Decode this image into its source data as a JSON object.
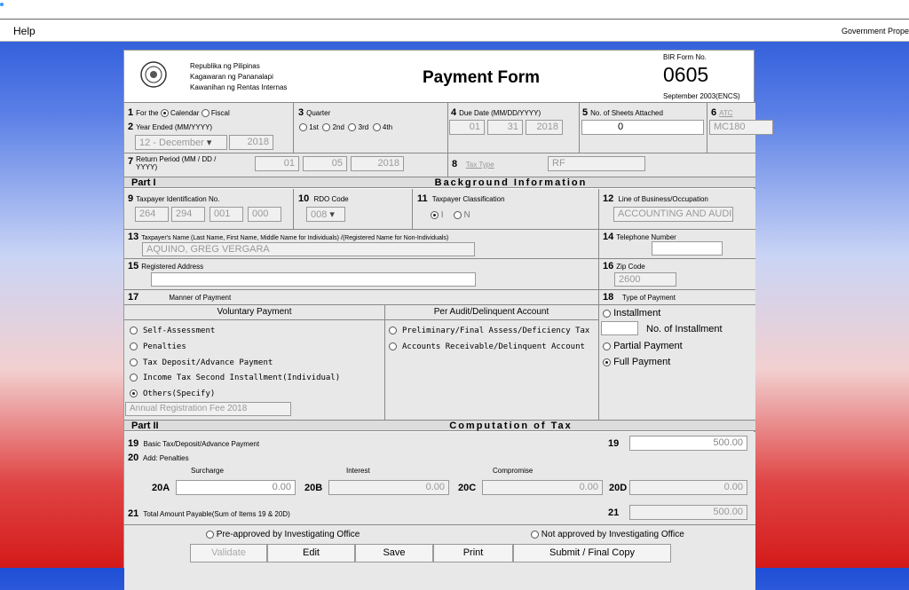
{
  "window": {
    "help": "Help",
    "gov": "Government Prope"
  },
  "header": {
    "line1": "Republika ng Pilipinas",
    "line2": "Kagawaran ng Pananalapi",
    "line3": "Kawanihan ng Rentas Internas",
    "title": "Payment Form",
    "bir_label": "BIR Form No.",
    "form_no": "0605",
    "edition": "September 2003(ENCS)"
  },
  "row1": {
    "f1_label": "For the",
    "calendar": "Calendar",
    "fiscal": "Fiscal",
    "f2_label": "Year Ended (MM/YYYY)",
    "month": "12 - December",
    "year": "2018",
    "f3_label": "Quarter",
    "q1": "1st",
    "q2": "2nd",
    "q3": "3rd",
    "q4": "4th",
    "f4_label": "Due Date (MM/DD/YYYY)",
    "due_mm": "01",
    "due_dd": "31",
    "due_yyyy": "2018",
    "f5_label": "No. of Sheets Attached",
    "sheets": "0",
    "f6_label": "ATC",
    "atc": "MC180"
  },
  "row2": {
    "f7_label": "Return Period (MM / DD / YYYY)",
    "rp_mm": "01",
    "rp_dd": "05",
    "rp_yyyy": "2018",
    "f8_label": "Tax Type",
    "tax_type": "RF"
  },
  "part1": {
    "p": "Part I",
    "t": "Background Information"
  },
  "bg": {
    "f9": "Taxpayer Identification No.",
    "tin1": "264",
    "tin2": "294",
    "tin3": "001",
    "tin4": "000",
    "f10": "RDO Code",
    "rdo": "008",
    "f11": "Taxpayer Classification",
    "cls_i": "I",
    "cls_n": "N",
    "f12": "Line of Business/Occupation",
    "business": "ACCOUNTING AND AUDI",
    "f13": "Taxpayer's Name (Last Name, First Name, Middle Name for Individuals) /(Registered Name for Non-Individuals)",
    "name": "AQUINO, GREG VERGARA",
    "f14": "Telephone Number",
    "f15": "Registered Address",
    "f16": "Zip Code",
    "zip": "2600"
  },
  "manner": {
    "f17": "Manner of Payment",
    "voluntary": "Voluntary Payment",
    "audit": "Per Audit/Delinquent Account",
    "o1": "Self-Assessment",
    "o2": "Penalties",
    "o3": "Tax Deposit/Advance Payment",
    "o4": "Income Tax Second Installment(Individual)",
    "o5": "Others(Specify)",
    "others_val": "Annual Registration Fee 2018",
    "a1": "Preliminary/Final Assess/Deficiency Tax",
    "a2": "Accounts Receivable/Delinquent Account",
    "f18": "Type of Payment",
    "t1": "Installment",
    "t1n": "No. of Installment",
    "t2": "Partial Payment",
    "t3": "Full Payment"
  },
  "part2": {
    "p": "Part II",
    "t": "Computation of Tax"
  },
  "comp": {
    "f19": "Basic Tax/Deposit/Advance Payment",
    "v19": "500.00",
    "f20": "Add: Penalties",
    "surcharge": "Surcharge",
    "interest": "Interest",
    "compromise": "Compromise",
    "v20a": "0.00",
    "v20b": "0.00",
    "v20c": "0.00",
    "v20d": "0.00",
    "f21": "Total Amount Payable(Sum of Items 19 & 20D)",
    "v21": "500.00",
    "pre": "Pre-approved by Investigating Office",
    "notpre": "Not approved by Investigating Office"
  },
  "buttons": {
    "validate": "Validate",
    "edit": "Edit",
    "save": "Save",
    "print": "Print",
    "submit": "Submit / Final Copy"
  }
}
